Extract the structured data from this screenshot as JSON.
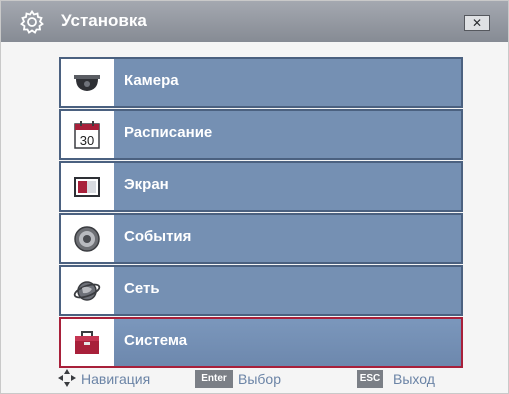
{
  "window": {
    "title": "Установка",
    "close_label": "✕"
  },
  "menu": {
    "items": [
      {
        "label": "Камера",
        "icon": "camera-icon",
        "selected": false
      },
      {
        "label": "Расписание",
        "icon": "calendar-icon",
        "icon_text": "30",
        "selected": false
      },
      {
        "label": "Экран",
        "icon": "display-icon",
        "selected": false
      },
      {
        "label": "События",
        "icon": "event-icon",
        "selected": false
      },
      {
        "label": "Сеть",
        "icon": "network-icon",
        "selected": false
      },
      {
        "label": "Система",
        "icon": "toolbox-icon",
        "selected": true
      }
    ]
  },
  "footer": {
    "navigation_label": "Навигация",
    "enter_key": "Enter",
    "enter_label": "Выбор",
    "esc_key": "ESC",
    "esc_label": "Выход"
  },
  "colors": {
    "titlebar": "#868b94",
    "item_bg": "#7590b3",
    "item_border": "#4b6180",
    "selected_border": "#a8203a",
    "footer_text": "#6b84a6"
  }
}
